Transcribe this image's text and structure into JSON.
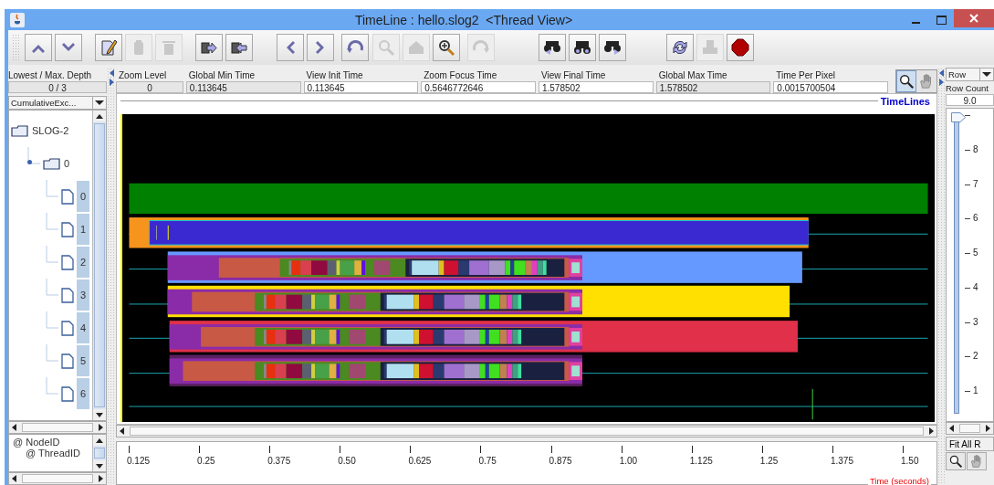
{
  "window": {
    "title": "TimeLine : hello.slog2  <Thread View>"
  },
  "toolbar": {
    "groups": [
      {
        "buttons": [
          {
            "kind": "up",
            "disabled": false
          },
          {
            "kind": "down",
            "disabled": false
          }
        ]
      },
      {
        "buttons": [
          {
            "kind": "edit",
            "disabled": false
          },
          {
            "kind": "paste",
            "disabled": true
          },
          {
            "kind": "delete",
            "disabled": true
          }
        ]
      },
      {
        "buttons": [
          {
            "kind": "export",
            "disabled": false
          },
          {
            "kind": "import",
            "disabled": false
          }
        ]
      },
      {
        "buttons": [
          {
            "kind": "back",
            "disabled": false
          },
          {
            "kind": "forward",
            "disabled": false
          }
        ]
      },
      {
        "buttons": [
          {
            "kind": "undo",
            "disabled": false
          }
        ]
      },
      {
        "buttons": [
          {
            "kind": "zoom_out",
            "disabled": true
          },
          {
            "kind": "home",
            "disabled": true
          },
          {
            "kind": "zoom_in",
            "disabled": false
          }
        ]
      },
      {
        "buttons": [
          {
            "kind": "redo",
            "disabled": true
          }
        ]
      },
      {
        "buttons": [
          {
            "kind": "search_back",
            "disabled": false
          },
          {
            "kind": "search",
            "disabled": false
          },
          {
            "kind": "search_forward",
            "disabled": false
          }
        ]
      },
      {
        "buttons": [
          {
            "kind": "refresh",
            "disabled": false
          },
          {
            "kind": "print",
            "disabled": true
          },
          {
            "kind": "stop",
            "disabled": false
          }
        ]
      }
    ]
  },
  "depth": {
    "label": "Lowest / Max. Depth",
    "value": "0 / 3"
  },
  "time_fields": [
    {
      "label": "Zoom Level",
      "value": "0",
      "editable": false
    },
    {
      "label": "Global Min Time",
      "value": "0.113645",
      "editable": false
    },
    {
      "label": "View  Init Time",
      "value": "0.113645",
      "editable": true
    },
    {
      "label": "Zoom Focus Time",
      "value": "0.5646772646",
      "editable": true
    },
    {
      "label": "View Final Time",
      "value": "1.578502",
      "editable": true
    },
    {
      "label": "Global Max Time",
      "value": "1.578502",
      "editable": false
    },
    {
      "label": "Time Per Pixel",
      "value": "0.0015700504",
      "editable": true
    }
  ],
  "mode_buttons": [
    {
      "kind": "zoom",
      "selected": true
    },
    {
      "kind": "hand",
      "selected": false
    }
  ],
  "legend_dropdown": {
    "value": "CumulativeExc..."
  },
  "tree": {
    "label": "SLOG-2",
    "selected": false,
    "children": [
      {
        "label": "0",
        "selected": false,
        "children": [
          {
            "label": "0",
            "selected": true
          },
          {
            "label": "1",
            "selected": true
          },
          {
            "label": "2",
            "selected": true
          },
          {
            "label": "3",
            "selected": true
          },
          {
            "label": "4",
            "selected": true
          },
          {
            "label": "5",
            "selected": true
          },
          {
            "label": "6",
            "selected": true
          }
        ]
      }
    ]
  },
  "attribute_list": [
    {
      "label": "@ NodeID",
      "children": [
        {
          "label": "@ ThreadID"
        }
      ]
    }
  ],
  "canvas": {
    "title": "TimeLines"
  },
  "time_axis": {
    "ticks": [
      "0.125",
      "0.25",
      "0.375",
      "0.50",
      "0.625",
      "0.75",
      "0.875",
      "1.00",
      "1.125",
      "1.25",
      "1.375",
      "1.50"
    ],
    "label": "Time (seconds)"
  },
  "row_panel": {
    "dropdown": "Row",
    "count_label": "Row Count",
    "count": "9.0",
    "slider": {
      "level": 1,
      "ticks": [
        "8",
        "7",
        "6",
        "5",
        "4",
        "3",
        "2",
        "1"
      ]
    },
    "fit_button": "Fit All R",
    "tools": [
      {
        "kind": "zoom"
      },
      {
        "kind": "hand"
      }
    ]
  }
}
